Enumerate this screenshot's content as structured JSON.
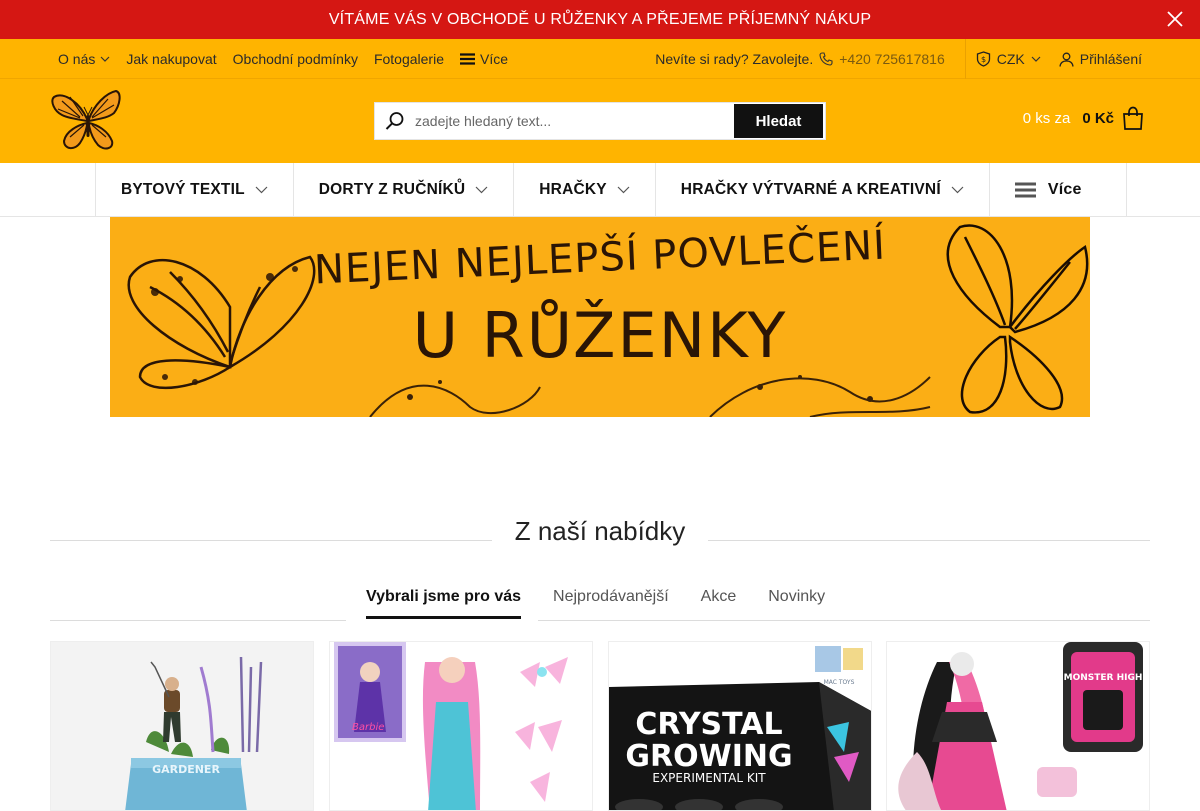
{
  "announcement": {
    "text": "VÍTÁME VÁS V OBCHODĚ U RŮŽENKY A PŘEJEME PŘÍJEMNÝ NÁKUP",
    "close_icon": "close-icon"
  },
  "topbar": {
    "links": [
      {
        "label": "O nás"
      },
      {
        "label": "Jak nakupovat"
      },
      {
        "label": "Obchodní podmínky"
      },
      {
        "label": "Fotogalerie"
      },
      {
        "label": "Více"
      }
    ],
    "help_text": "Nevíte si rady? Zavolejte.",
    "phone": "+420 725617816",
    "currency": "CZK",
    "login": "Přihlášení"
  },
  "header": {
    "search_placeholder": "zadejte hledaný text...",
    "search_button": "Hledat",
    "cart_count": "0 ks za",
    "cart_price": "0 Kč"
  },
  "categories": [
    {
      "label": "BYTOVÝ TEXTIL"
    },
    {
      "label": "DORTY Z RUČNÍKŮ"
    },
    {
      "label": "HRAČKY"
    },
    {
      "label": "HRAČKY VÝTVARNÉ A KREATIVNÍ"
    },
    {
      "label": "Více"
    }
  ],
  "banner": {
    "line1": "NEJEN NEJLEPŠÍ POVLEČENÍ",
    "line2": "U RŮŽENKY"
  },
  "section": {
    "title": "Z naší nabídky"
  },
  "tabs": [
    {
      "label": "Vybrali jsme pro vás",
      "active": true
    },
    {
      "label": "Nejprodávanější"
    },
    {
      "label": "Akce"
    },
    {
      "label": "Novinky"
    }
  ],
  "products": [
    {
      "image_text": "GARDENER"
    },
    {
      "image_text": "Barbie"
    },
    {
      "image_text_1": "CRYSTAL",
      "image_text_2": "GROWING",
      "image_text_3": "EXPERIMENTAL KIT",
      "brand_badge": "MAC TOYS"
    },
    {
      "image_text": "MONSTER HIGH"
    }
  ],
  "colors": {
    "announce_bg": "#d51713",
    "brand_yellow": "#ffb400",
    "banner_bg": "#fbae15"
  }
}
